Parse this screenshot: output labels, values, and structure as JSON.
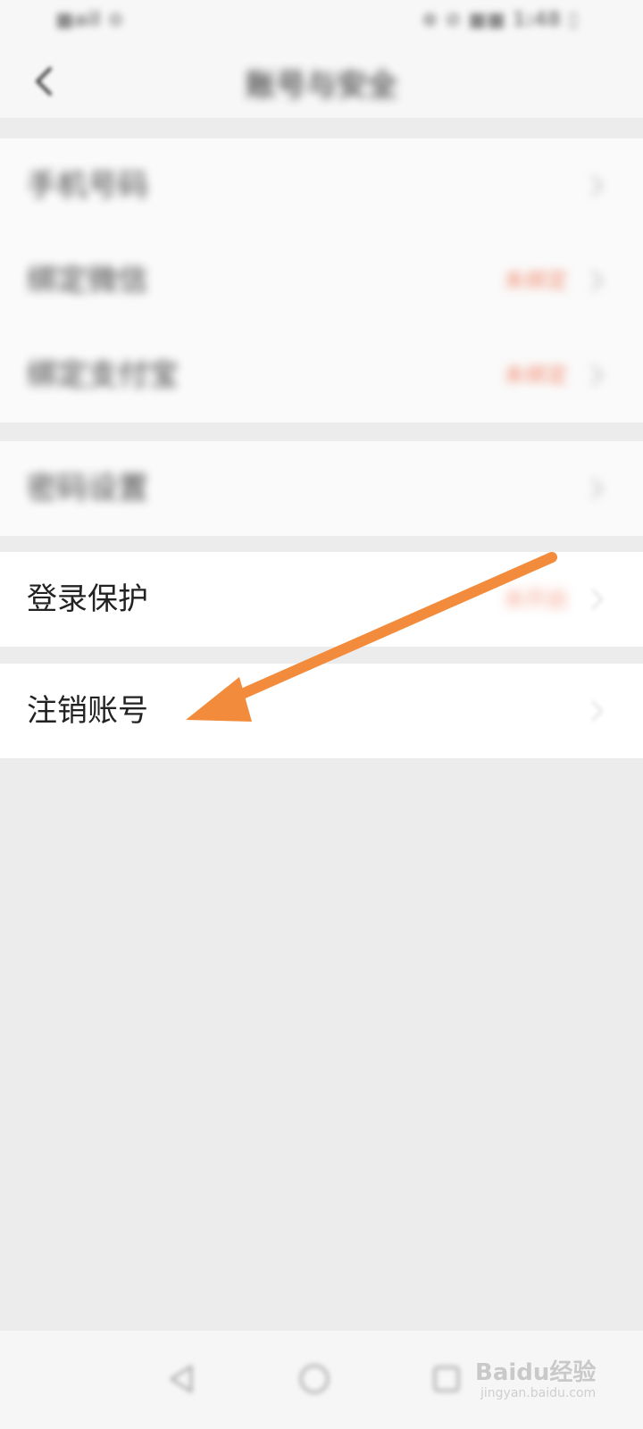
{
  "status_bar": {
    "left_text": "■ail ⊙",
    "right_text": "⊕ ⊘ ■■ 1:48 ▯"
  },
  "header": {
    "title": "账号与安全",
    "back_icon": "chevron-left-icon"
  },
  "rows": [
    {
      "label": "手机号码",
      "status": "",
      "blurred": true
    },
    {
      "label": "绑定微信",
      "status": "未绑定",
      "blurred": true
    },
    {
      "label": "绑定支付宝",
      "status": "未绑定",
      "blurred": true
    },
    {
      "label": "密码设置",
      "status": "",
      "blurred": true
    },
    {
      "label": "登录保护",
      "status": "未开启",
      "blurred": false
    },
    {
      "label": "注销账号",
      "status": "",
      "blurred": false
    }
  ],
  "colors": {
    "accent_status": "#f07a5a",
    "annotation_arrow": "#f28c3c",
    "background": "#ececec"
  },
  "annotation": {
    "icon": "arrow-icon",
    "target": "注销账号"
  },
  "nav": {
    "back_icon": "triangle-back-icon",
    "home_icon": "circle-home-icon",
    "recents_icon": "square-recents-icon"
  },
  "watermark": {
    "main": "Baidu经验",
    "sub": "jingyan.baidu.com"
  }
}
